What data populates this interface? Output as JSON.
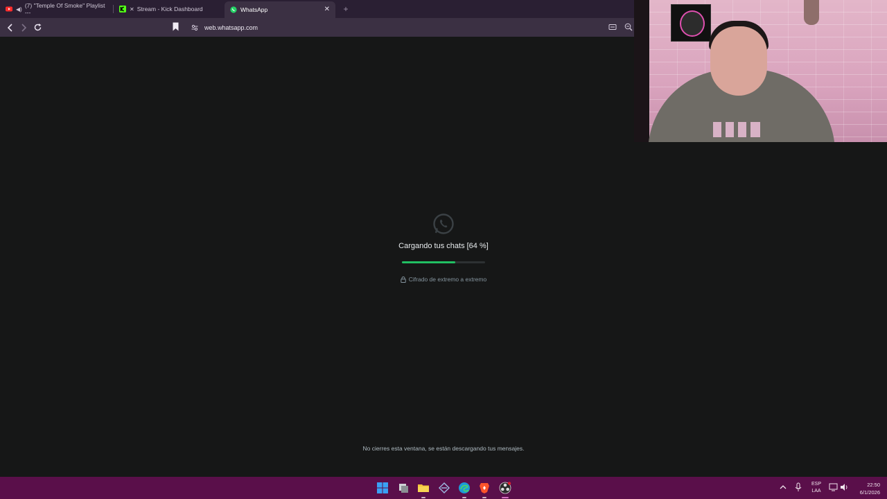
{
  "browser": {
    "tabs": [
      {
        "label": "(7) \"Temple Of Smoke\" Playlist ---",
        "icon": "youtube-icon",
        "extra_icon": "speaker-icon"
      },
      {
        "label": "Stream - Kick Dashboard",
        "icon": "kick-icon",
        "extra_icon": "muted-speaker-icon"
      },
      {
        "label": "WhatsApp",
        "icon": "whatsapp-icon",
        "close": "✕"
      }
    ],
    "new_tab": "+",
    "url": "web.whatsapp.com"
  },
  "whatsapp": {
    "loading_text": "Cargando tus chats [64 %]",
    "progress": 0.64,
    "encryption_text": "Cifrado de extremo a extremo",
    "footer_note": "No cierres esta ventana, se están descargando tus mensajes."
  },
  "colors": {
    "accent": "#21c063",
    "background": "#161717",
    "taskbar": "#5a0f4a"
  },
  "taskbar": {
    "apps": [
      "windows-start-icon",
      "task-view-icon",
      "file-explorer-icon",
      "app-icon",
      "edge-icon",
      "brave-icon",
      "obs-icon"
    ],
    "language_line1": "ESP",
    "language_line2": "LAA",
    "time": "22:50",
    "date": "6/1/2026"
  }
}
